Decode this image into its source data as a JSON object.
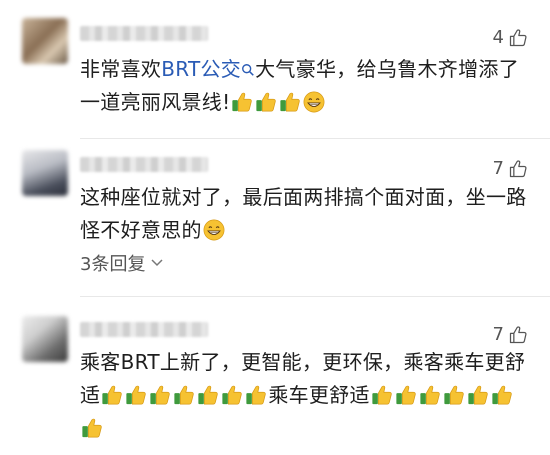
{
  "comments": [
    {
      "likes": "4",
      "text_a": "非常喜欢",
      "link": "BRT公交",
      "text_b": "大气豪华，给乌鲁木齐增添了",
      "text_c": "一道亮丽风景线!"
    },
    {
      "likes": "7",
      "line1": "这种座位就对了，最后面两排搞个面对面，坐一路",
      "line2": "怪不好意思的",
      "replies": "3条回复"
    },
    {
      "likes": "7",
      "line1": "乘客BRT上新了，更智能，更环保，乘客乘车更舒",
      "line2_a": "适",
      "line2_b": "乘车更舒适"
    }
  ],
  "icons": {
    "thumbs_up": "thumbs-up-emoji",
    "grin": "grinning-emoji",
    "like": "thumb-outline-icon",
    "search": "search-icon",
    "chevron": "chevron-down-icon"
  },
  "colors": {
    "link": "#2a5bb5",
    "emoji_yellow": "#f6c232",
    "sleeve_green": "#3f9a3d"
  }
}
